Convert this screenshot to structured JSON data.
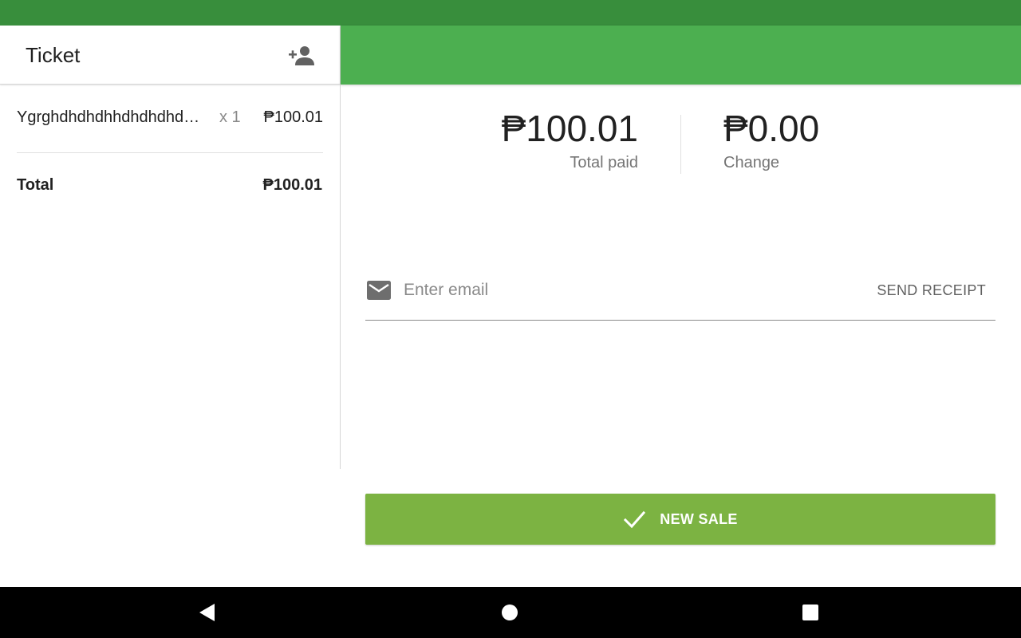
{
  "ticket": {
    "title": "Ticket",
    "add_customer_icon": "person-add-icon",
    "items": [
      {
        "name": "Ygrghdhdhdhhdhdhdhdhd",
        "display_name": "Ygrghdhdhdhhdhdhdhd…",
        "qty": "x 1",
        "price": "₱100.01"
      }
    ],
    "total_label": "Total",
    "total_value": "₱100.01"
  },
  "payment": {
    "total_paid_amount": "₱100.01",
    "total_paid_label": "Total paid",
    "change_amount": "₱0.00",
    "change_label": "Change"
  },
  "receipt": {
    "email_placeholder": "Enter email",
    "email_value": "",
    "mail_icon": "mail-icon",
    "send_label": "SEND RECEIPT"
  },
  "actions": {
    "new_sale_label": "NEW SALE",
    "new_sale_icon": "check-icon"
  },
  "nav": {
    "back_icon": "back-triangle-icon",
    "home_icon": "home-circle-icon",
    "recents_icon": "recents-square-icon"
  },
  "colors": {
    "status_bar": "#388e3c",
    "header": "#4caf50",
    "new_sale_button": "#7cb342",
    "nav_bar": "#000000"
  }
}
